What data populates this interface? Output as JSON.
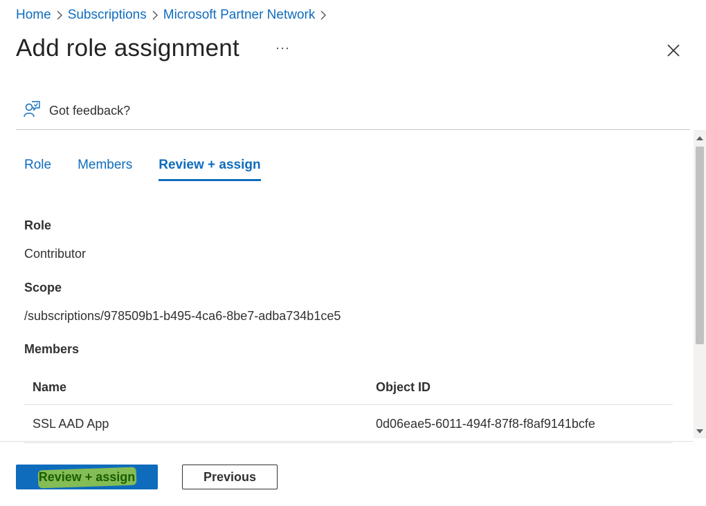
{
  "breadcrumb": {
    "items": [
      {
        "label": "Home"
      },
      {
        "label": "Subscriptions"
      },
      {
        "label": "Microsoft Partner Network"
      }
    ]
  },
  "page": {
    "title": "Add role assignment",
    "more_icon": "ellipsis-icon",
    "close_icon": "close-icon"
  },
  "feedback": {
    "label": "Got feedback?",
    "icon": "feedback-person-icon"
  },
  "tabs": [
    {
      "label": "Role",
      "active": false
    },
    {
      "label": "Members",
      "active": false
    },
    {
      "label": "Review + assign",
      "active": true
    }
  ],
  "review": {
    "role_label": "Role",
    "role_value": "Contributor",
    "scope_label": "Scope",
    "scope_value": "/subscriptions/978509b1-b495-4ca6-8be7-adba734b1ce5",
    "members_label": "Members",
    "members_table": {
      "headers": [
        "Name",
        "Object ID"
      ],
      "rows": [
        [
          "SSL AAD App",
          "0d06eae5-6011-494f-87f8-f8af9141bcfe"
        ]
      ]
    }
  },
  "footer": {
    "primary_label": "Review + assign",
    "secondary_label": "Previous"
  },
  "colors": {
    "accent": "#0f6cbd",
    "highlight": "#e6ff00"
  }
}
